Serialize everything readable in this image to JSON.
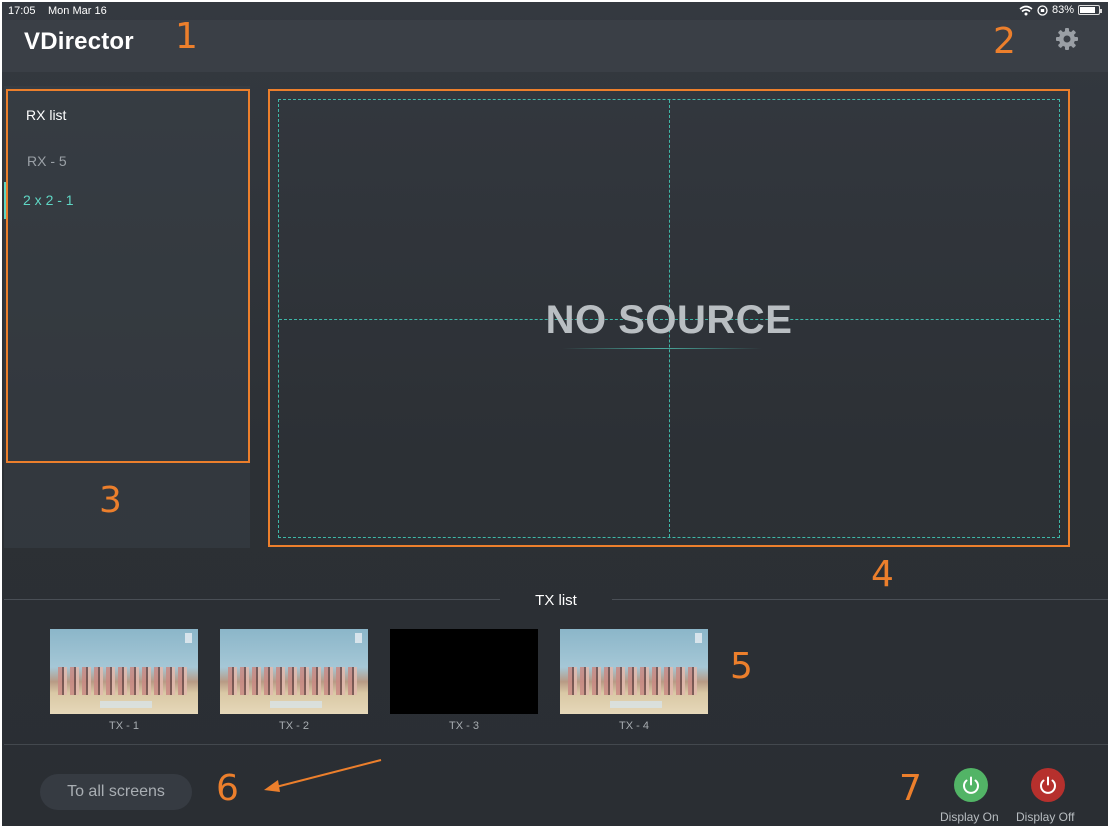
{
  "status_bar": {
    "time": "17:05",
    "date": "Mon Mar 16",
    "battery": "83%"
  },
  "app": {
    "logo": "VDirector"
  },
  "annotations": [
    "1",
    "2",
    "3",
    "4",
    "5",
    "6",
    "7"
  ],
  "rx_panel": {
    "title": "RX list",
    "items": [
      {
        "label": "RX - 5",
        "selected": false
      },
      {
        "label": "2 x 2 - 1",
        "selected": true
      }
    ]
  },
  "preview": {
    "status_text": "NO SOURCE",
    "grid": "2x2"
  },
  "tx_panel": {
    "title": "TX list",
    "items": [
      {
        "label": "TX - 1",
        "thumbnail": "video"
      },
      {
        "label": "TX - 2",
        "thumbnail": "video"
      },
      {
        "label": "TX - 3",
        "thumbnail": "black"
      },
      {
        "label": "TX - 4",
        "thumbnail": "video"
      }
    ]
  },
  "actions": {
    "to_all_screens": "To all screens",
    "display_on": "Display On",
    "display_off": "Display Off"
  },
  "colors": {
    "accent": "#5fd6c4",
    "annotation": "#ec7f2c",
    "display_on": "#52b466",
    "display_off": "#b6302d"
  },
  "icons": {
    "settings": "gear-icon",
    "power": "power-icon",
    "wifi": "wifi-icon",
    "battery": "battery-icon"
  }
}
